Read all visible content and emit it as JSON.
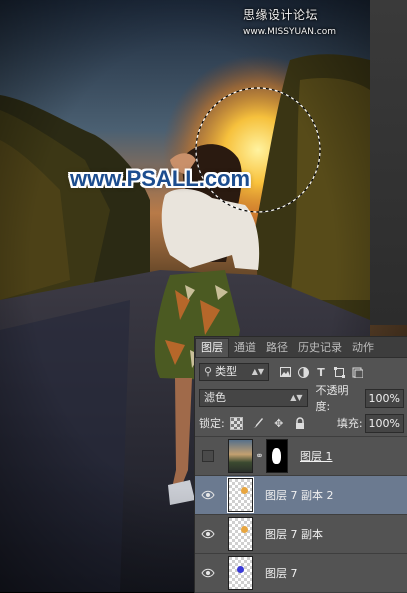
{
  "watermark": {
    "main": "思缘设计论坛",
    "site": "www.MISSYUAN.com"
  },
  "logo_text": "www.PSALL.com",
  "panel": {
    "tabs": [
      {
        "label": "图层",
        "active": true
      },
      {
        "label": "通道",
        "active": false
      },
      {
        "label": "路径",
        "active": false
      },
      {
        "label": "历史记录",
        "active": false
      },
      {
        "label": "动作",
        "active": false
      }
    ],
    "filter": {
      "kind_label": "类型",
      "icons": [
        "image-filter-icon",
        "adjustment-filter-icon",
        "type-filter-icon",
        "shape-filter-icon",
        "smart-object-filter-icon"
      ]
    },
    "blend_mode": "滤色",
    "opacity_label": "不透明度:",
    "opacity_value": "100%",
    "lock_label": "锁定:",
    "fill_label": "填充:",
    "fill_value": "100%",
    "layers": [
      {
        "name": "图层 1",
        "visible": false,
        "selected": false,
        "type": "photo-with-mask"
      },
      {
        "name": "图层 7 副本 2",
        "visible": true,
        "selected": true,
        "type": "transparent",
        "dot_color": "#e8a640"
      },
      {
        "name": "图层 7 副本",
        "visible": true,
        "selected": false,
        "type": "transparent",
        "dot_color": "#e8a640"
      },
      {
        "name": "图层 7",
        "visible": true,
        "selected": false,
        "type": "transparent",
        "dot_color": "#3a3ad8"
      }
    ]
  },
  "colors": {
    "panel_bg": "#535353",
    "selected_row": "#6b7a90",
    "sun": "#ffd24a",
    "logo_blue": "#1c4d8f"
  }
}
